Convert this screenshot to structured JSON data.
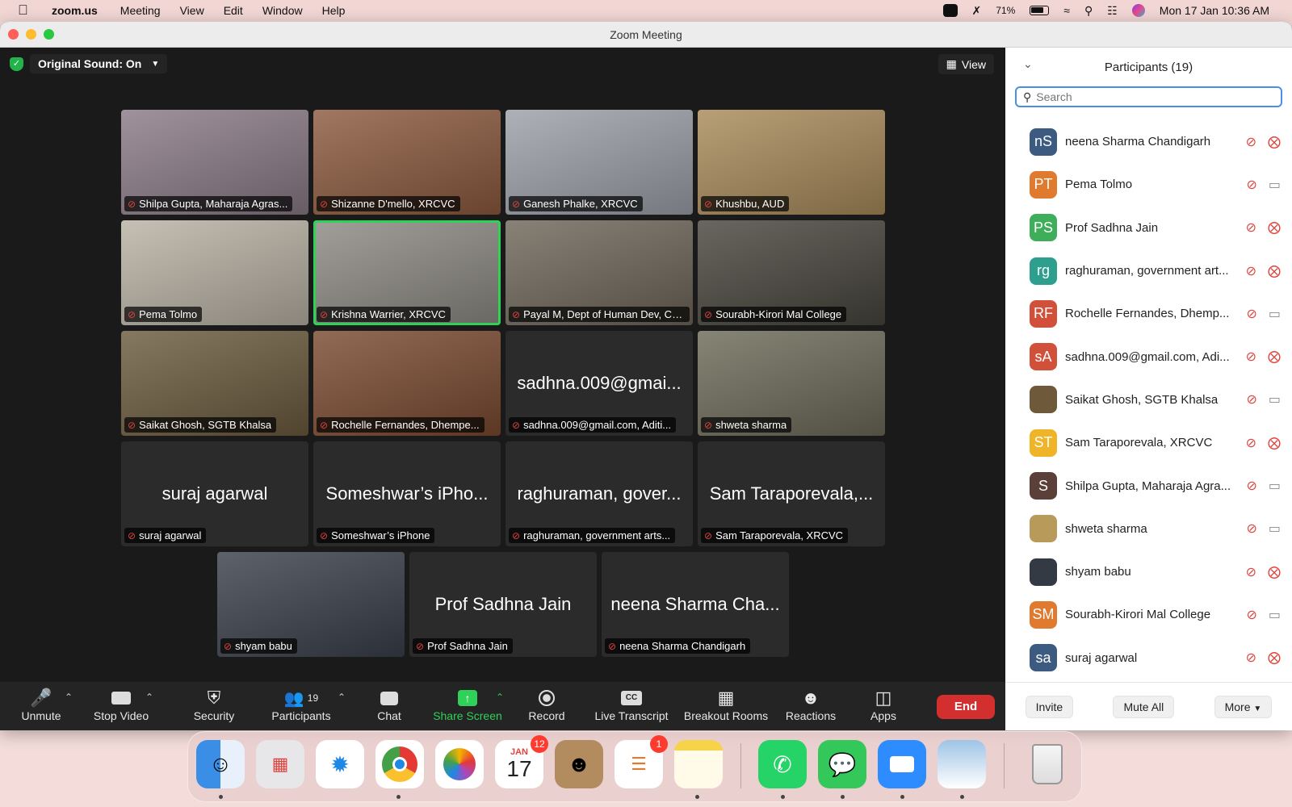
{
  "menubar": {
    "app_name": "zoom.us",
    "items": [
      "Meeting",
      "View",
      "Edit",
      "Window",
      "Help"
    ],
    "battery": "71%",
    "datetime": "Mon 17 Jan  10:36 AM"
  },
  "window": {
    "title": "Zoom Meeting"
  },
  "topbar": {
    "original_sound": "Original Sound: On",
    "view_label": "View"
  },
  "tiles": [
    {
      "big": "",
      "label": "Shilpa Gupta, Maharaja Agras...",
      "color": "#8a7a86"
    },
    {
      "big": "",
      "label": "Shizanne D'mello, XRCVC",
      "color": "#8c5a3e"
    },
    {
      "big": "",
      "label": "Ganesh Phalke, XRCVC",
      "color": "#9ca0a8"
    },
    {
      "big": "",
      "label": "Khushbu, AUD",
      "color": "#a88a5a"
    },
    {
      "big": "",
      "label": "Pema Tolmo",
      "color": "#b9b2a4"
    },
    {
      "big": "",
      "label": "Krishna Warrier, XRCVC",
      "color": "#8d8a84"
    },
    {
      "big": "",
      "label": "Payal M, Dept of Human Dev, Col...",
      "color": "#6e6659"
    },
    {
      "big": "",
      "label": "Sourabh-Kirori Mal College",
      "color": "#47453c"
    },
    {
      "big": "",
      "label": "Saikat Ghosh, SGTB Khalsa",
      "color": "#6b5b3e"
    },
    {
      "big": "",
      "label": "Rochelle Fernandes, Dhempe...",
      "color": "#7a4a30"
    },
    {
      "big": "sadhna.009@gmai...",
      "label": "sadhna.009@gmail.com, Aditi...",
      "color": "#2b2b2b"
    },
    {
      "big": "",
      "label": "shweta sharma",
      "color": "#6c6a58"
    },
    {
      "big": "suraj agarwal",
      "label": "suraj agarwal",
      "color": "#2b2b2b"
    },
    {
      "big": "Someshwar’s iPho...",
      "label": "Someshwar’s iPhone",
      "color": "#2b2b2b"
    },
    {
      "big": "raghuraman, gover...",
      "label": "raghuraman, government arts...",
      "color": "#2b2b2b"
    },
    {
      "big": "Sam Taraporevala,...",
      "label": "Sam Taraporevala, XRCVC",
      "color": "#2b2b2b"
    },
    {
      "big": "",
      "label": "shyam babu",
      "color": "#3a3f4a"
    },
    {
      "big": "Prof Sadhna Jain",
      "label": "Prof Sadhna Jain",
      "color": "#2b2b2b"
    },
    {
      "big": "neena Sharma Cha...",
      "label": "neena Sharma Chandigarh",
      "color": "#2b2b2b"
    }
  ],
  "toolbar": {
    "unmute": "Unmute",
    "stop_video": "Stop Video",
    "security": "Security",
    "participants": "Participants",
    "participants_count": "19",
    "chat": "Chat",
    "share_screen": "Share Screen",
    "record": "Record",
    "live_transcript": "Live Transcript",
    "breakout_rooms": "Breakout Rooms",
    "reactions": "Reactions",
    "apps": "Apps",
    "end": "End"
  },
  "panel": {
    "title": "Participants (19)",
    "search_placeholder": "Search",
    "participants": [
      {
        "initials": "nS",
        "name": "neena Sharma Chandigarh",
        "color": "#3d5a80",
        "video": "off"
      },
      {
        "initials": "PT",
        "name": "Pema Tolmo",
        "color": "#e07a2e",
        "video": "on"
      },
      {
        "initials": "PS",
        "name": "Prof Sadhna Jain",
        "color": "#3fae5b",
        "video": "off"
      },
      {
        "initials": "rg",
        "name": "raghuraman, government art...",
        "color": "#2e9e8f",
        "video": "off"
      },
      {
        "initials": "RF",
        "name": "Rochelle Fernandes, Dhemp...",
        "color": "#d0503a",
        "video": "on"
      },
      {
        "initials": "sA",
        "name": "sadhna.009@gmail.com, Adi...",
        "color": "#d0503a",
        "video": "off"
      },
      {
        "initials": "",
        "name": "Saikat Ghosh, SGTB Khalsa",
        "color": "#6e5a3a",
        "video": "on"
      },
      {
        "initials": "ST",
        "name": "Sam Taraporevala, XRCVC",
        "color": "#f0b429",
        "video": "off"
      },
      {
        "initials": "S",
        "name": "Shilpa Gupta, Maharaja Agra...",
        "color": "#5a4038",
        "video": "on"
      },
      {
        "initials": "",
        "name": "shweta sharma",
        "color": "#b89a5a",
        "video": "on"
      },
      {
        "initials": "",
        "name": "shyam babu",
        "color": "#333a44",
        "video": "off"
      },
      {
        "initials": "SM",
        "name": "Sourabh-Kirori Mal College",
        "color": "#e07a2e",
        "video": "on"
      },
      {
        "initials": "sa",
        "name": "suraj agarwal",
        "color": "#3d5a80",
        "video": "off"
      }
    ],
    "invite": "Invite",
    "mute_all": "Mute All",
    "more": "More"
  },
  "dock": {
    "calendar_month": "JAN",
    "calendar_day": "17",
    "calendar_badge": "12",
    "reminders_badge": "1"
  }
}
